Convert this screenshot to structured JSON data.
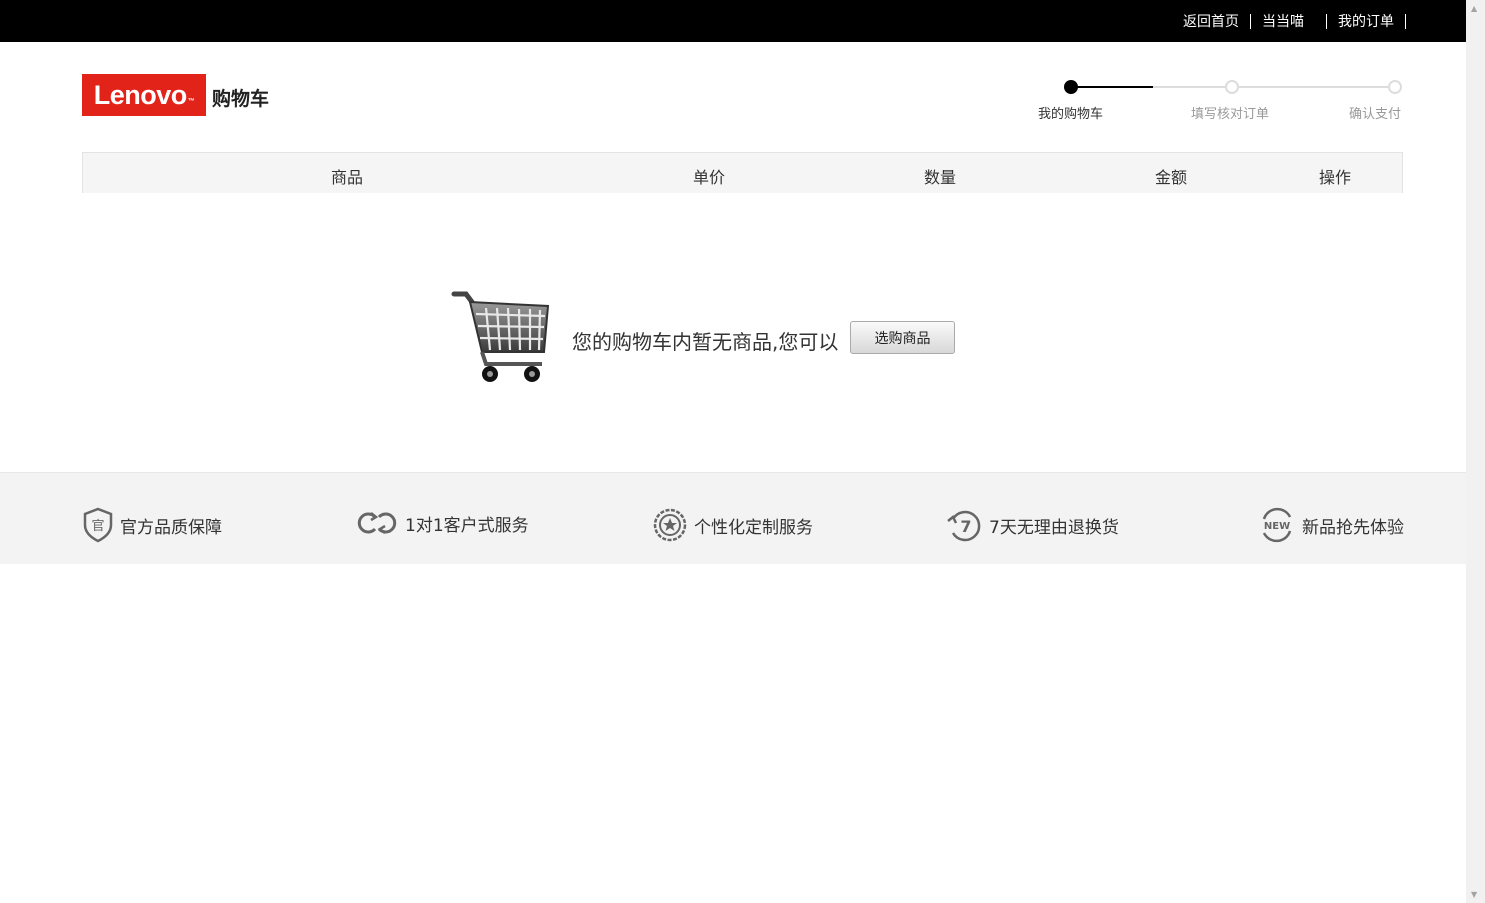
{
  "topnav": {
    "home": "返回首页",
    "dangdang": "当当喵",
    "orders": "我的订单"
  },
  "header": {
    "brand": "Lenovo",
    "page_title": "购物车"
  },
  "steps": [
    {
      "label": "我的购物车",
      "state": "active"
    },
    {
      "label": "填写核对订单",
      "state": "pending"
    },
    {
      "label": "确认支付",
      "state": "pending"
    }
  ],
  "table_header": {
    "product": "商品",
    "unit_price": "单价",
    "quantity": "数量",
    "amount": "金额",
    "action": "操作"
  },
  "empty_cart": {
    "message": "您的购物车内暂无商品,您可以",
    "button": "选购商品"
  },
  "services": [
    {
      "icon": "shield-icon",
      "label": "官方品质保障"
    },
    {
      "icon": "one-to-one-icon",
      "label": "1对1客户式服务"
    },
    {
      "icon": "star-badge-icon",
      "label": "个性化定制服务"
    },
    {
      "icon": "seven-day-return-icon",
      "label": "7天无理由退换货"
    },
    {
      "icon": "new-icon",
      "label": "新品抢先体验"
    }
  ],
  "colors": {
    "brand_red": "#e2231a",
    "topbar": "#000000",
    "strip": "#f3f3f3"
  }
}
